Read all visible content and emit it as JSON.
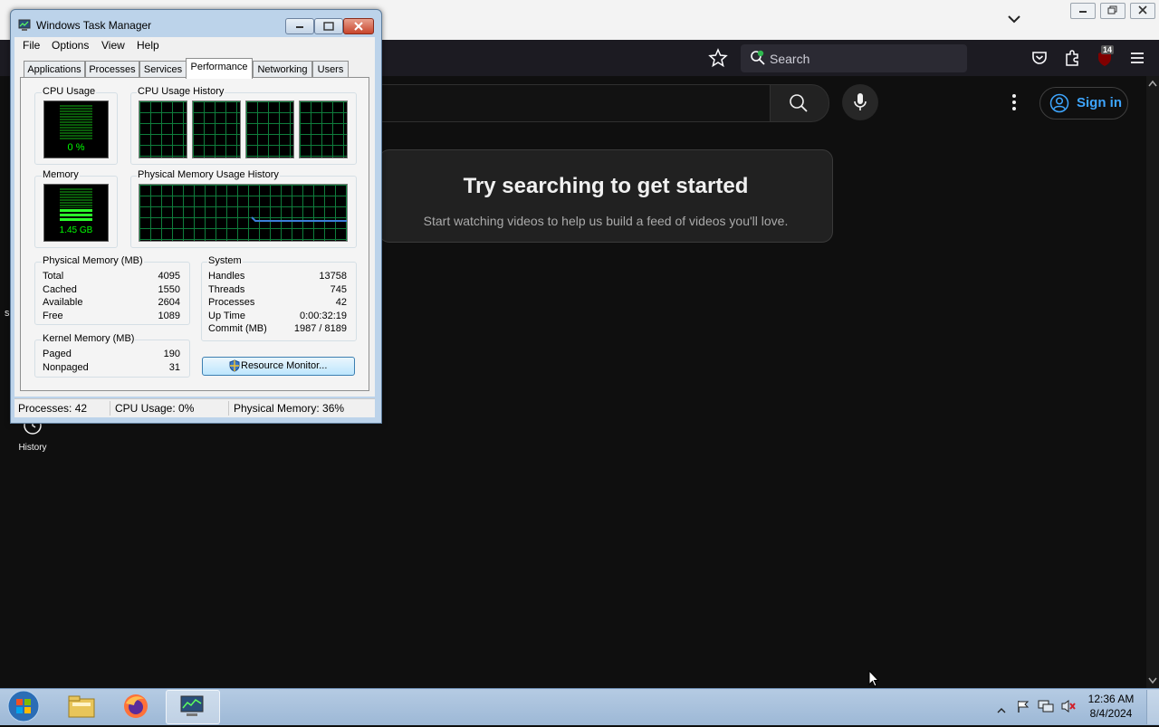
{
  "browser": {
    "search_placeholder": "Search",
    "extensions_badge": "14"
  },
  "youtube": {
    "sign_in": "Sign in",
    "card_title": "Try searching to get started",
    "card_subtitle": "Start watching videos to help us build a feed of videos you'll love.",
    "sidebar_history": "History",
    "left_edge_fragment": "s"
  },
  "taskmgr": {
    "title": "Windows Task Manager",
    "menu": [
      "File",
      "Options",
      "View",
      "Help"
    ],
    "tabs": [
      "Applications",
      "Processes",
      "Services",
      "Performance",
      "Networking",
      "Users"
    ],
    "active_tab": "Performance",
    "cpu_usage_label": "CPU Usage",
    "cpu_usage_value": "0 %",
    "cpu_history_label": "CPU Usage History",
    "memory_label": "Memory",
    "memory_value": "1.45 GB",
    "memory_history_label": "Physical Memory Usage History",
    "physical_memory": {
      "label": "Physical Memory (MB)",
      "rows": [
        {
          "k": "Total",
          "v": "4095"
        },
        {
          "k": "Cached",
          "v": "1550"
        },
        {
          "k": "Available",
          "v": "2604"
        },
        {
          "k": "Free",
          "v": "1089"
        }
      ]
    },
    "kernel_memory": {
      "label": "Kernel Memory (MB)",
      "rows": [
        {
          "k": "Paged",
          "v": "190"
        },
        {
          "k": "Nonpaged",
          "v": "31"
        }
      ]
    },
    "system": {
      "label": "System",
      "rows": [
        {
          "k": "Handles",
          "v": "13758"
        },
        {
          "k": "Threads",
          "v": "745"
        },
        {
          "k": "Processes",
          "v": "42"
        },
        {
          "k": "Up Time",
          "v": "0:00:32:19"
        },
        {
          "k": "Commit (MB)",
          "v": "1987 / 8189"
        }
      ]
    },
    "resource_monitor_button": "Resource Monitor...",
    "status": {
      "processes": "Processes: 42",
      "cpu": "CPU Usage: 0%",
      "memory": "Physical Memory: 36%"
    }
  },
  "taskbar": {
    "time": "12:36 AM",
    "date": "8/4/2024"
  },
  "colors": {
    "youtube_bg": "#0f0f0f",
    "signin_blue": "#3ea6ff",
    "graph_green": "#00ff00",
    "memory_history_line": "#3b7dd8"
  }
}
